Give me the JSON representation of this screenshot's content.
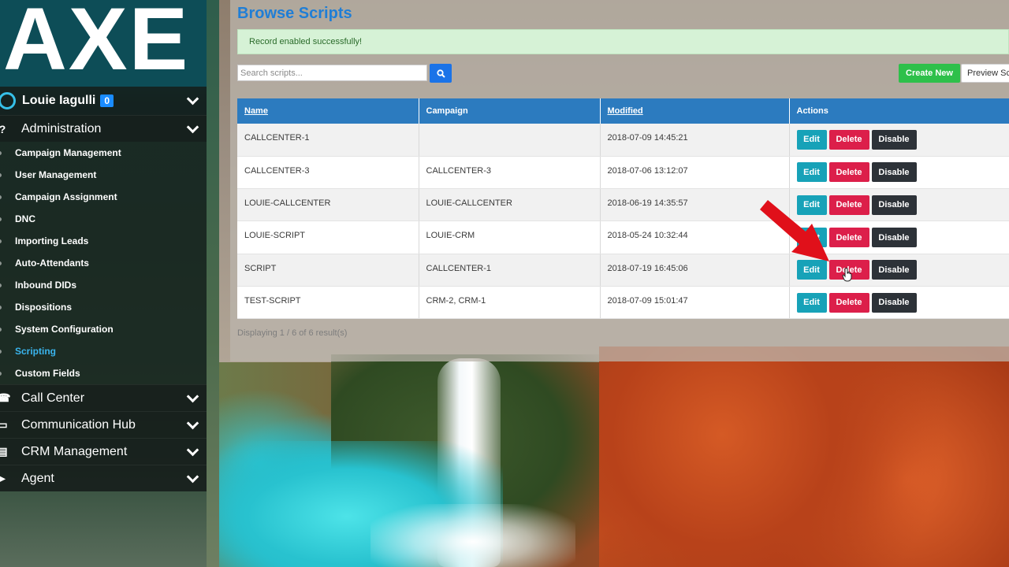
{
  "sidebar": {
    "logo": "AXE",
    "user": {
      "name": "Louie Iagulli",
      "badge": "0"
    },
    "sections": {
      "administration": "Administration",
      "call_center": "Call Center",
      "communication_hub": "Communication Hub",
      "crm_management": "CRM Management",
      "agent": "Agent"
    },
    "admin_items": [
      {
        "label": "Campaign Management"
      },
      {
        "label": "User Management"
      },
      {
        "label": "Campaign Assignment"
      },
      {
        "label": "DNC"
      },
      {
        "label": "Importing Leads"
      },
      {
        "label": "Auto-Attendants"
      },
      {
        "label": "Inbound DIDs"
      },
      {
        "label": "Dispositions"
      },
      {
        "label": "System Configuration"
      },
      {
        "label": "Scripting"
      },
      {
        "label": "Custom Fields"
      }
    ],
    "active_item": "Scripting"
  },
  "main": {
    "title": "Browse Scripts",
    "alert": "Record enabled successfully!",
    "search": {
      "placeholder": "Search scripts...",
      "value": ""
    },
    "create_label": "Create New",
    "preview_label": "Preview Sc",
    "table": {
      "headers": [
        "Name",
        "Campaign",
        "Modified",
        "Actions"
      ],
      "rows": [
        {
          "name": "CALLCENTER-1",
          "campaign": "",
          "modified": "2018-07-09 14:45:21"
        },
        {
          "name": "CALLCENTER-3",
          "campaign": "CALLCENTER-3",
          "modified": "2018-07-06 13:12:07"
        },
        {
          "name": "LOUIE-CALLCENTER",
          "campaign": "LOUIE-CALLCENTER",
          "modified": "2018-06-19 14:35:57"
        },
        {
          "name": "LOUIE-SCRIPT",
          "campaign": "LOUIE-CRM",
          "modified": "2018-05-24 10:32:44"
        },
        {
          "name": "SCRIPT",
          "campaign": "CALLCENTER-1",
          "modified": "2018-07-19 16:45:06"
        },
        {
          "name": "TEST-SCRIPT",
          "campaign": "CRM-2, CRM-1",
          "modified": "2018-07-09 15:01:47"
        }
      ],
      "actions": {
        "edit": "Edit",
        "delete": "Delete",
        "disable": "Disable"
      }
    },
    "footer": "Displaying 1 / 6 of 6 result(s)"
  },
  "colors": {
    "title_blue": "#1f7ed6",
    "header_blue": "#2c7bbf",
    "edit": "#17a2b8",
    "delete": "#dc1f4a",
    "disable": "#2d3238",
    "create": "#2ec04a",
    "active_nav": "#3ab5ee",
    "annotation_arrow": "#e0101a"
  }
}
